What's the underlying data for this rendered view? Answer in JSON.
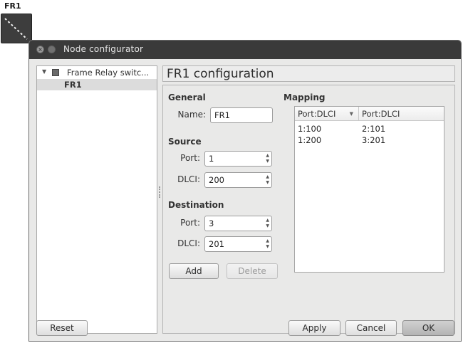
{
  "node": {
    "label": "FR1",
    "icon": "frame-relay-switch-icon"
  },
  "window": {
    "title": "Node configurator"
  },
  "tree": {
    "group_label": "Frame Relay switc...",
    "selected_item": "FR1"
  },
  "config": {
    "title": "FR1 configuration"
  },
  "general": {
    "heading": "General",
    "name_label": "Name:",
    "name_value": "FR1"
  },
  "source": {
    "heading": "Source",
    "port_label": "Port:",
    "port_value": "1",
    "dlci_label": "DLCI:",
    "dlci_value": "200"
  },
  "destination": {
    "heading": "Destination",
    "port_label": "Port:",
    "port_value": "3",
    "dlci_label": "DLCI:",
    "dlci_value": "201"
  },
  "buttons": {
    "add": "Add",
    "delete": "Delete",
    "reset": "Reset",
    "apply": "Apply",
    "cancel": "Cancel",
    "ok": "OK"
  },
  "mapping": {
    "heading": "Mapping",
    "columns": [
      "Port:DLCI",
      "Port:DLCI"
    ],
    "rows": [
      [
        "1:100",
        "2:101"
      ],
      [
        "1:200",
        "3:201"
      ]
    ]
  }
}
